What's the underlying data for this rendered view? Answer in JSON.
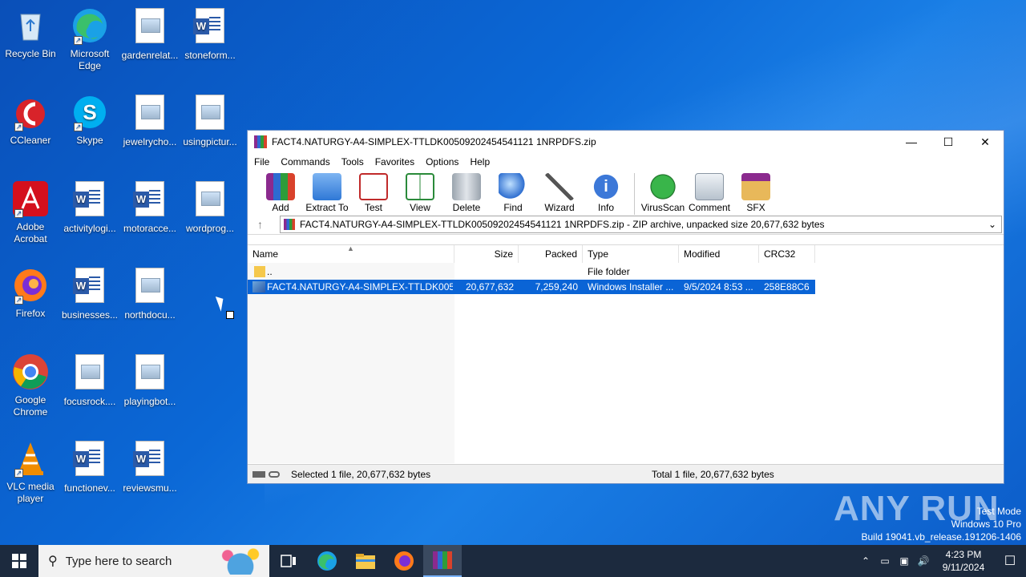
{
  "desktop": {
    "icons": [
      {
        "label": "Recycle Bin"
      },
      {
        "label": "Microsoft Edge"
      },
      {
        "label": "gardenrelat..."
      },
      {
        "label": "stoneform..."
      },
      {
        "label": "CCleaner"
      },
      {
        "label": "Skype"
      },
      {
        "label": "jewelrycho..."
      },
      {
        "label": "usingpictur..."
      },
      {
        "label": "Adobe Acrobat"
      },
      {
        "label": "activitylogi..."
      },
      {
        "label": "motoracce..."
      },
      {
        "label": "wordprog..."
      },
      {
        "label": "Firefox"
      },
      {
        "label": "businesses..."
      },
      {
        "label": "northdocu..."
      },
      {
        "label": "Google Chrome"
      },
      {
        "label": "focusrock...."
      },
      {
        "label": "playingbot..."
      },
      {
        "label": "VLC media player"
      },
      {
        "label": "functionev..."
      },
      {
        "label": "reviewsmu..."
      }
    ]
  },
  "window": {
    "title": "FACT4.NATURGY-A4-SIMPLEX-TTLDK00509202454541121 1NRPDFS.zip",
    "menu": [
      "File",
      "Commands",
      "Tools",
      "Favorites",
      "Options",
      "Help"
    ],
    "toolbar": [
      "Add",
      "Extract To",
      "Test",
      "View",
      "Delete",
      "Find",
      "Wizard",
      "Info",
      "VirusScan",
      "Comment",
      "SFX"
    ],
    "address": "FACT4.NATURGY-A4-SIMPLEX-TTLDK00509202454541121 1NRPDFS.zip - ZIP archive, unpacked size 20,677,632 bytes",
    "columns": [
      "Name",
      "Size",
      "Packed",
      "Type",
      "Modified",
      "CRC32"
    ],
    "rows": [
      {
        "name": "..",
        "size": "",
        "packed": "",
        "type": "File folder",
        "modified": "",
        "crc": ""
      },
      {
        "name": "FACT4.NATURGY-A4-SIMPLEX-TTLDK0050...",
        "size": "20,677,632",
        "packed": "7,259,240",
        "type": "Windows Installer ...",
        "modified": "9/5/2024 8:53 ...",
        "crc": "258E88C6"
      }
    ],
    "status_left": "Selected 1 file, 20,677,632 bytes",
    "status_right": "Total 1 file, 20,677,632 bytes"
  },
  "watermark": {
    "brand": "ANY RUN",
    "line1": "Test Mode",
    "line2": "Windows 10 Pro",
    "line3": "Build 19041.vb_release.191206-1406"
  },
  "taskbar": {
    "search_placeholder": "Type here to search",
    "time": "4:23 PM",
    "date": "9/11/2024"
  },
  "colors": {
    "selection": "#0a64d6",
    "taskbar": "#1c2a3e"
  }
}
